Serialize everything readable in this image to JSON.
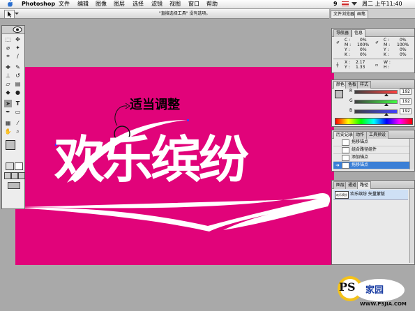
{
  "menubar": {
    "app_name": "Photoshop",
    "items": [
      "文件",
      "编辑",
      "图像",
      "图层",
      "选择",
      "滤镜",
      "视图",
      "窗口",
      "帮助"
    ],
    "status_number": "9",
    "clock": "周二 上午11:40"
  },
  "options_bar": {
    "hint": "\"直接选择工具\" 没有选项。"
  },
  "palette_well": {
    "tabs": [
      "文件浏览器",
      "画笔"
    ]
  },
  "canvas": {
    "annotation": "适当调整",
    "headline": "欢乐缤纷",
    "bg_color": "#e1037a",
    "text_color": "#ffffff"
  },
  "navigator_panel": {
    "tabs": [
      "导航器",
      "信息"
    ],
    "cmyk_labels": [
      "C :",
      "M :",
      "Y :",
      "K :"
    ],
    "cmyk_values_left": [
      "0%",
      "100%",
      "0%",
      "0%"
    ],
    "cmyk_values_right": [
      "0%",
      "100%",
      "0%",
      "0%"
    ],
    "x_label": "X :",
    "y_label": "Y :",
    "x_value": "2.17",
    "y_value": "1.33",
    "w_label": "W :",
    "h_label": "H :"
  },
  "color_panel": {
    "tabs": [
      "颜色",
      "色板",
      "样式"
    ],
    "channels": [
      {
        "label": "R",
        "value": "192"
      },
      {
        "label": "G",
        "value": "192"
      },
      {
        "label": "B",
        "value": "192"
      }
    ]
  },
  "history_panel": {
    "tabs": [
      "历史记录",
      "动作",
      "工具预设"
    ],
    "rows": [
      "拖移锚点",
      "组合路径组件",
      "添加锚点",
      "拖移锚点"
    ],
    "selected_index": 3
  },
  "layers_panel": {
    "tabs": [
      "图层",
      "通道",
      "路径"
    ],
    "row_thumb": "欢乐缤纷",
    "row_label": "欢乐缤纷 矢量蒙版"
  },
  "watermark": {
    "brand": "PS",
    "brand_cn": "家园",
    "url": "WWW.PSJIA.COM"
  }
}
